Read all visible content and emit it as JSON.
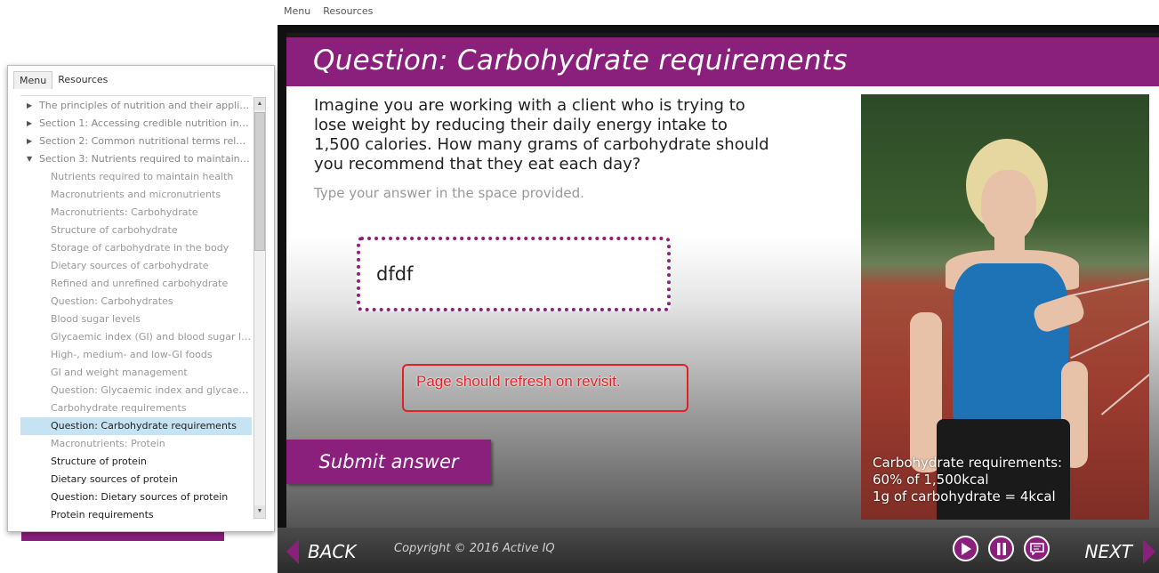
{
  "top_tabs": {
    "menu": "Menu",
    "resources": "Resources"
  },
  "slide": {
    "title": "Question: Carbohydrate requirements",
    "question_lines": [
      "Imagine you are working with a client who is trying to",
      "lose weight by reducing their daily energy intake to",
      "1,500 calories. How many grams of carbohydrate should",
      "you recommend that they eat each day?"
    ],
    "instruction": "Type your answer in the space provided.",
    "answer_value": "dfdf",
    "annotation": "Page should refresh on revisit.",
    "submit_label": "Submit answer",
    "caption_lines": [
      "Carbohydrate requirements:",
      "60% of 1,500kcal",
      "1g of carbohydrate = 4kcal"
    ]
  },
  "navbar": {
    "back_label": "BACK",
    "next_label": "NEXT",
    "copyright": "Copyright © 2016 Active IQ"
  },
  "menu_panel": {
    "tabs": [
      "Menu",
      "Resources"
    ],
    "items": [
      {
        "label": "The principles of nutrition and their application ...",
        "level": 0,
        "arrow": "▶"
      },
      {
        "label": "Section 1: Accessing credible nutrition informati...",
        "level": 0,
        "arrow": "▶"
      },
      {
        "label": "Section 2: Common nutritional terms related to ...",
        "level": 0,
        "arrow": "▶"
      },
      {
        "label": "Section 3: Nutrients required to maintain health",
        "level": 0,
        "arrow": "▼"
      },
      {
        "label": "Nutrients required to maintain health",
        "level": 1
      },
      {
        "label": "Macronutrients and micronutrients",
        "level": 1
      },
      {
        "label": "Macronutrients: Carbohydrate",
        "level": 1
      },
      {
        "label": "Structure of carbohydrate",
        "level": 1
      },
      {
        "label": "Storage of carbohydrate in the body",
        "level": 1
      },
      {
        "label": "Dietary sources of carbohydrate",
        "level": 1
      },
      {
        "label": "Refined and unrefined carbohydrate",
        "level": 1
      },
      {
        "label": "Question: Carbohydrates",
        "level": 1
      },
      {
        "label": "Blood sugar levels",
        "level": 1
      },
      {
        "label": "Glycaemic index (GI) and blood sugar levels",
        "level": 1
      },
      {
        "label": "High-, medium- and low-GI foods",
        "level": 1
      },
      {
        "label": "GI and weight management",
        "level": 1
      },
      {
        "label": "Question: Glycaemic index and glycaemic load",
        "level": 1
      },
      {
        "label": "Carbohydrate requirements",
        "level": 1
      },
      {
        "label": "Question: Carbohydrate requirements",
        "level": 1,
        "selected": true
      },
      {
        "label": "Macronutrients: Protein",
        "level": 1
      },
      {
        "label": "Structure of protein",
        "level": 1,
        "dark": true
      },
      {
        "label": "Dietary sources of protein",
        "level": 1,
        "dark": true
      },
      {
        "label": "Question: Dietary sources of protein",
        "level": 1,
        "dark": true
      },
      {
        "label": "Protein requirements",
        "level": 1,
        "dark": true
      }
    ]
  },
  "colors": {
    "brand_purple": "#8a1f7c",
    "selected_row": "#c5e3f2",
    "annotation_red": "#e0202a"
  }
}
